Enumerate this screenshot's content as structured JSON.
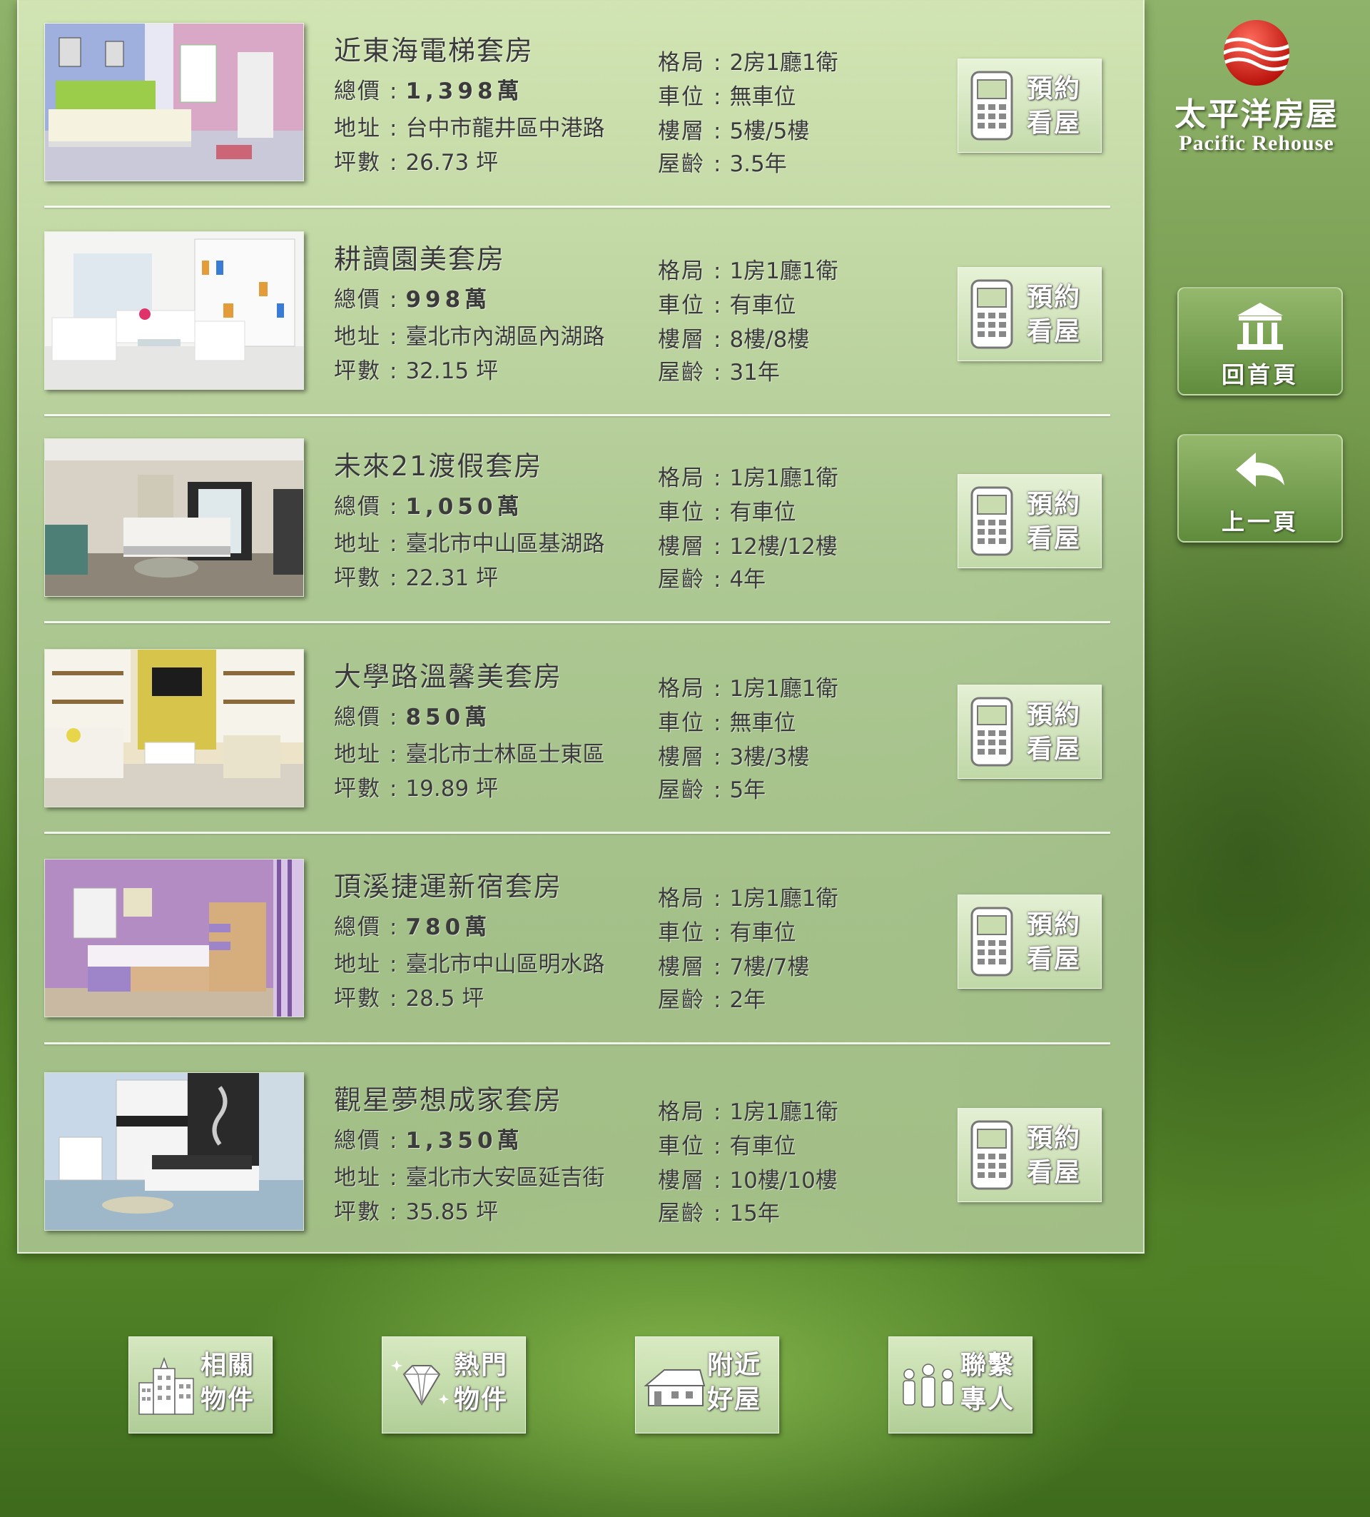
{
  "brand": {
    "name_cn": "太平洋房屋",
    "name_en": "Pacific Rehouse",
    "logo_color": "#d8261c"
  },
  "labels": {
    "price": "總價",
    "address": "地址",
    "area": "坪數",
    "layout": "格局",
    "parking": "車位",
    "floor": "樓層",
    "age": "屋齡",
    "colon": ":",
    "area_unit": "坪",
    "price_unit": "萬",
    "book_line1": "預約",
    "book_line2": "看屋"
  },
  "listings": [
    {
      "title": "近東海電梯套房",
      "price": "1,398",
      "address": "台中市龍井區中港路",
      "area": "26.73",
      "layout": "2房1廳1衛",
      "parking": "無車位",
      "floor": "5樓/5樓",
      "age": "3.5年",
      "photo": "pink-lilac-bedroom"
    },
    {
      "title": "耕讀園美套房",
      "price": "998",
      "address": "臺北市內湖區內湖路",
      "area": "32.15",
      "layout": "1房1廳1衛",
      "parking": "有車位",
      "floor": "8樓/8樓",
      "age": "31年",
      "photo": "white-living-room"
    },
    {
      "title": "未來21渡假套房",
      "price": "1,050",
      "address": "臺北市中山區基湖路",
      "area": "22.31",
      "layout": "1房1廳1衛",
      "parking": "有車位",
      "floor": "12樓/12樓",
      "age": "4年",
      "photo": "hotel-bedroom"
    },
    {
      "title": "大學路溫馨美套房",
      "price": "850",
      "address": "臺北市士林區士東區",
      "area": "19.89",
      "layout": "1房1廳1衛",
      "parking": "無車位",
      "floor": "3樓/3樓",
      "age": "5年",
      "photo": "yellow-living-room"
    },
    {
      "title": "頂溪捷運新宿套房",
      "price": "780",
      "address": "臺北市中山區明水路",
      "area": "28.5",
      "layout": "1房1廳1衛",
      "parking": "有車位",
      "floor": "7樓/7樓",
      "age": "2年",
      "photo": "purple-kids-room"
    },
    {
      "title": "觀星夢想成家套房",
      "price": "1,350",
      "address": "臺北市大安區延吉街",
      "area": "35.85",
      "layout": "1房1廳1衛",
      "parking": "有車位",
      "floor": "10樓/10樓",
      "age": "15年",
      "photo": "modern-black-white-bedroom"
    }
  ],
  "side_nav": {
    "home": "回首頁",
    "back": "上一頁"
  },
  "bottom_nav": [
    {
      "line1": "相關",
      "line2": "物件",
      "icon": "buildings-icon"
    },
    {
      "line1": "熱門",
      "line2": "物件",
      "icon": "diamond-icon"
    },
    {
      "line1": "附近",
      "line2": "好屋",
      "icon": "house-icon"
    },
    {
      "line1": "聯繫",
      "line2": "專人",
      "icon": "people-icon"
    }
  ]
}
